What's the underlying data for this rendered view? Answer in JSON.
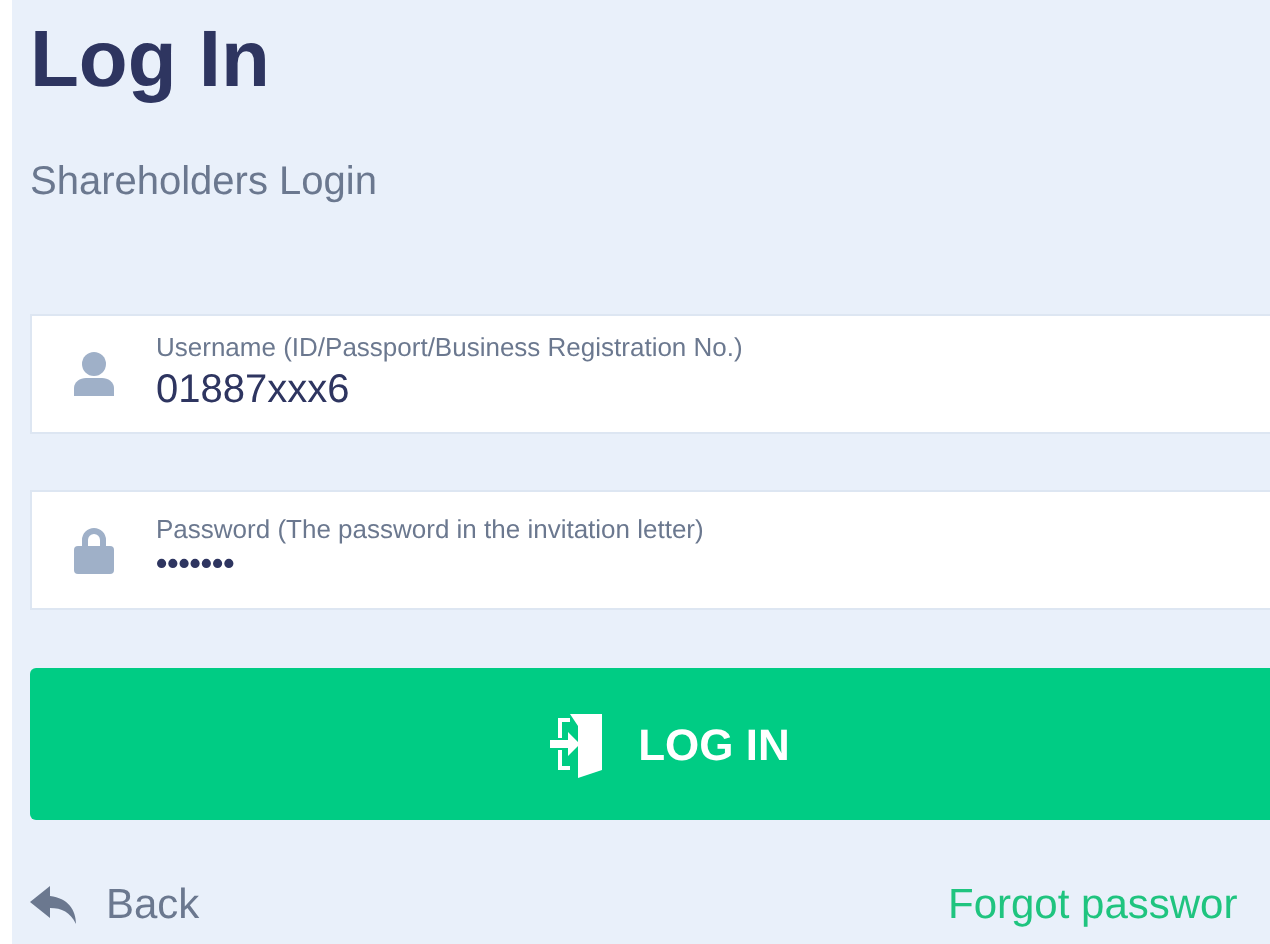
{
  "title": "Log In",
  "subtitle": "Shareholders Login",
  "fields": [
    {
      "kind": "user",
      "label": "Username (ID/Passport/Business Registration No.)",
      "value": "01887xxx6"
    },
    {
      "kind": "lock",
      "label": "Password (The password in the invitation letter)",
      "value": "•••••••"
    }
  ],
  "login_button": "LOG IN",
  "back_link": "Back",
  "forgot_link": "Forgot passwor"
}
